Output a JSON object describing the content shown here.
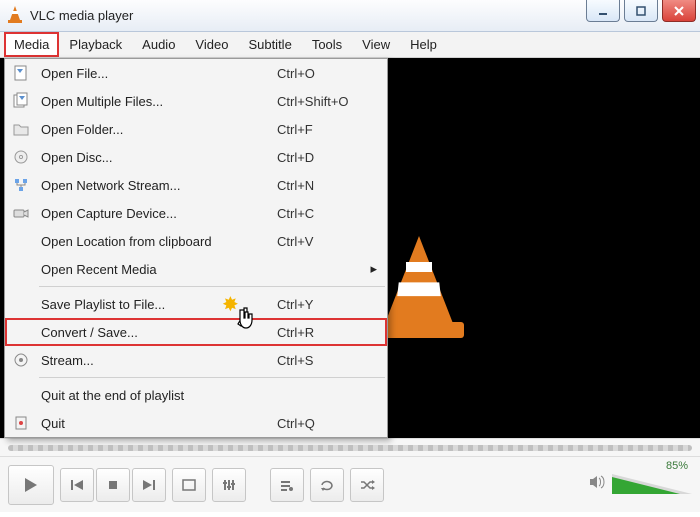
{
  "window": {
    "title": "VLC media player"
  },
  "menubar": {
    "items": [
      "Media",
      "Playback",
      "Audio",
      "Video",
      "Subtitle",
      "Tools",
      "View",
      "Help"
    ]
  },
  "media_menu": {
    "open_file": {
      "label": "Open File...",
      "shortcut": "Ctrl+O"
    },
    "open_multiple": {
      "label": "Open Multiple Files...",
      "shortcut": "Ctrl+Shift+O"
    },
    "open_folder": {
      "label": "Open Folder...",
      "shortcut": "Ctrl+F"
    },
    "open_disc": {
      "label": "Open Disc...",
      "shortcut": "Ctrl+D"
    },
    "open_network": {
      "label": "Open Network Stream...",
      "shortcut": "Ctrl+N"
    },
    "open_capture": {
      "label": "Open Capture Device...",
      "shortcut": "Ctrl+C"
    },
    "open_clipboard": {
      "label": "Open Location from clipboard",
      "shortcut": "Ctrl+V"
    },
    "open_recent": {
      "label": "Open Recent Media",
      "shortcut": ""
    },
    "save_playlist": {
      "label": "Save Playlist to File...",
      "shortcut": "Ctrl+Y"
    },
    "convert_save": {
      "label": "Convert / Save...",
      "shortcut": "Ctrl+R"
    },
    "stream": {
      "label": "Stream...",
      "shortcut": "Ctrl+S"
    },
    "quit_end": {
      "label": "Quit at the end of playlist",
      "shortcut": ""
    },
    "quit": {
      "label": "Quit",
      "shortcut": "Ctrl+Q"
    }
  },
  "controls": {
    "volume_percent": "85%"
  },
  "colors": {
    "highlight": "#d33",
    "cone": "#e27b1f",
    "volume_fill": "#34a634"
  }
}
